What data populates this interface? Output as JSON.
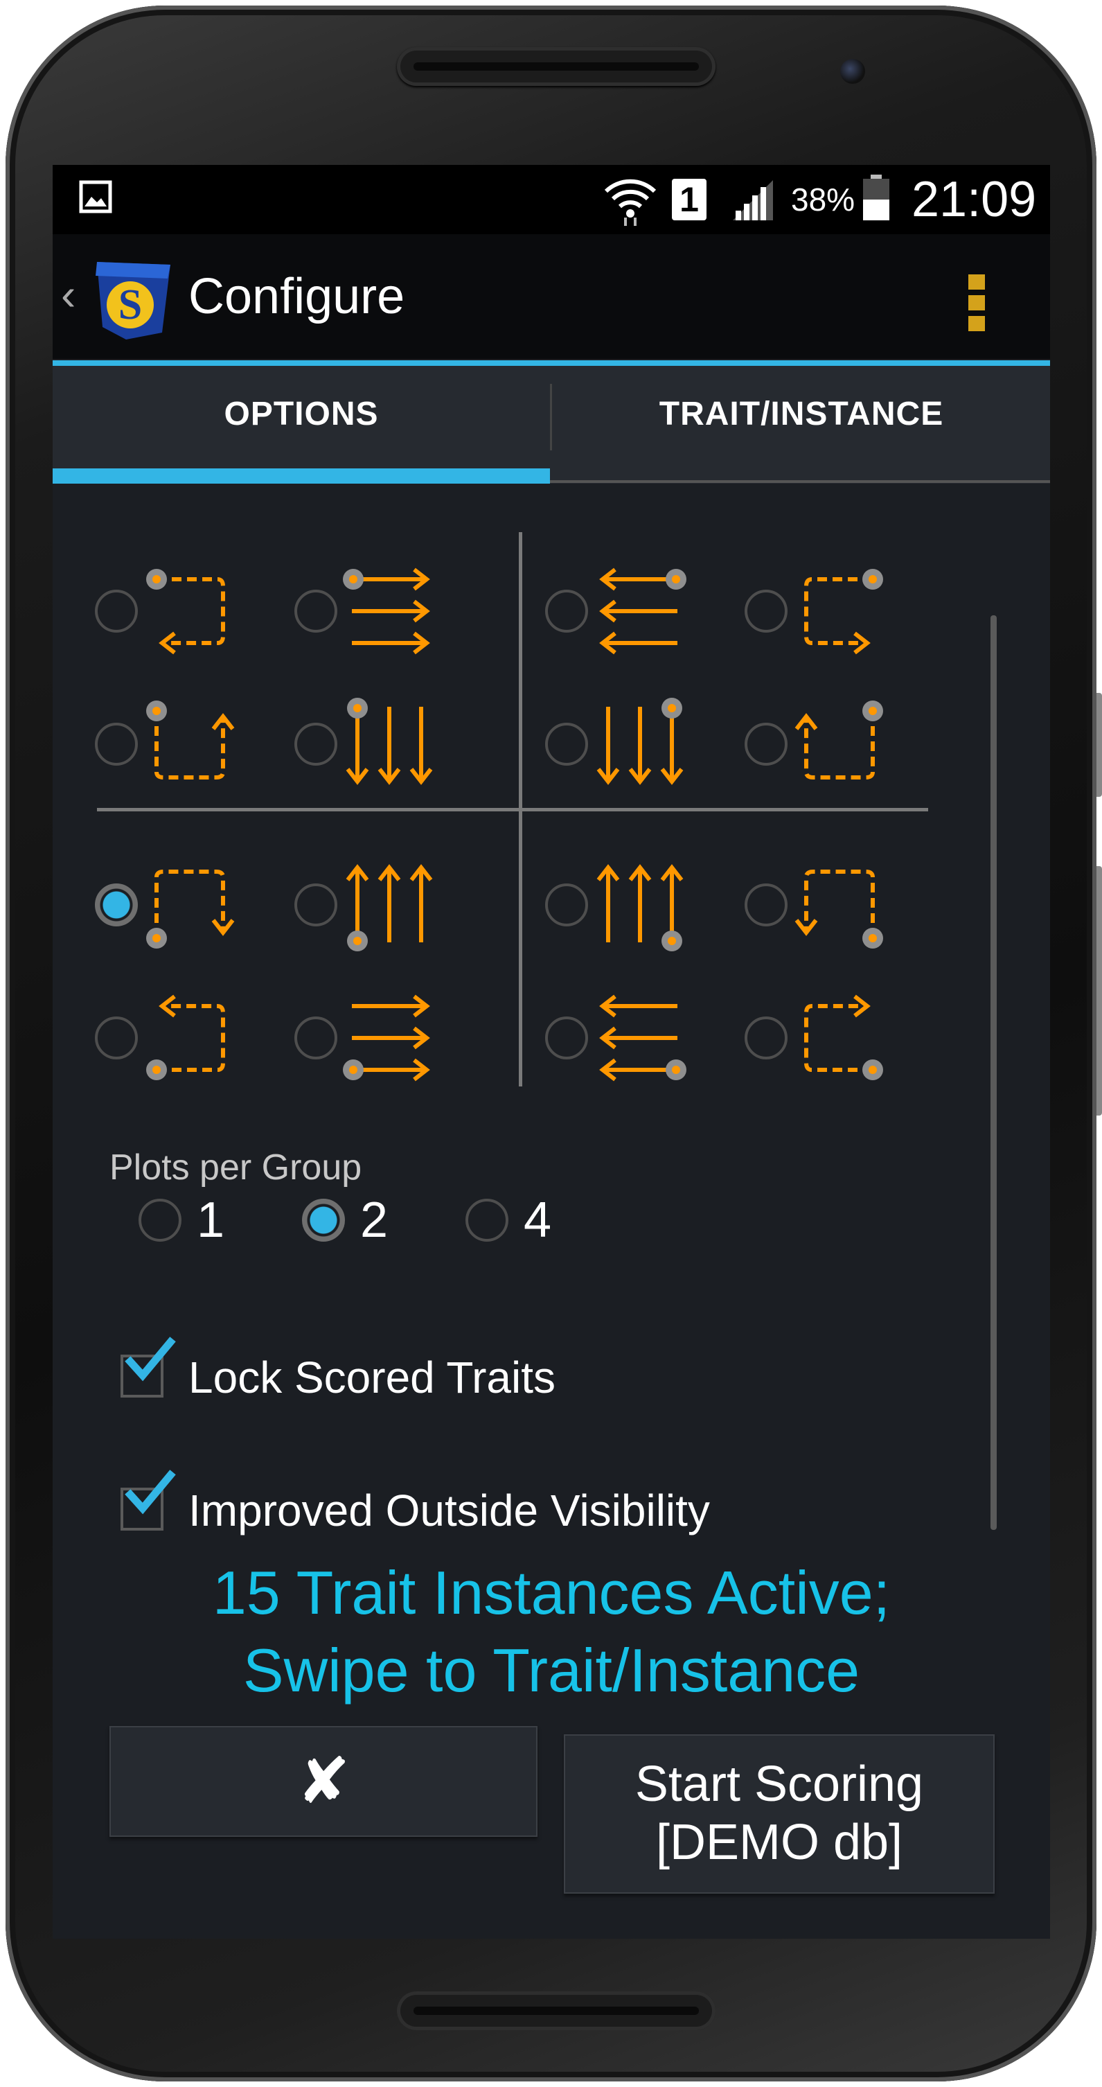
{
  "status_bar": {
    "battery_percent": "38%",
    "time": "21:09",
    "sim_slot": "1",
    "icons": [
      "gallery-notification-icon",
      "wifi-icon",
      "sim-icon",
      "signal-icon",
      "battery-icon"
    ]
  },
  "action_bar": {
    "title": "Configure",
    "back_glyph": "‹",
    "logo": "app-logo-s-shield",
    "overflow": "overflow-menu-icon"
  },
  "tabs": [
    {
      "label": "OPTIONS",
      "selected": true
    },
    {
      "label": "TRAIT/INSTANCE",
      "selected": false
    }
  ],
  "scoring_patterns": {
    "selected_index": 8,
    "count": 16,
    "accent_color": "#ff9800",
    "start_dot_color": "#8f8f8f"
  },
  "plots_per_group": {
    "label": "Plots per Group",
    "options": [
      "1",
      "2",
      "4"
    ],
    "selected": "2"
  },
  "options": {
    "lock_scored_traits": {
      "label": "Lock Scored Traits",
      "checked": true
    },
    "improved_outside_visibility": {
      "label": "Improved Outside Visibility",
      "checked": true
    }
  },
  "summary": {
    "line1": "15 Trait Instances Active;",
    "line2": "Swipe to Trait/Instance"
  },
  "buttons": {
    "cancel_label": "✘",
    "start_line1": "Start Scoring",
    "start_line2": "[DEMO db]"
  },
  "colors": {
    "accent": "#33b5e5",
    "summary_text": "#17c2e8",
    "pattern": "#ff9800",
    "overflow": "#d4a21b"
  }
}
